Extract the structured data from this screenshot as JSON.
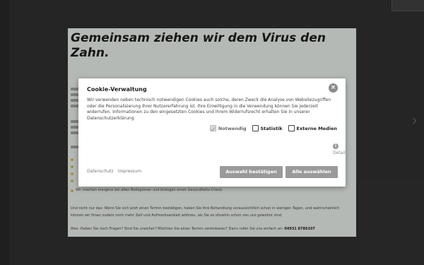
{
  "page": {
    "headline": "Gemeinsam ziehen wir dem Virus den Zahn.",
    "bullet_text": "Wir machen morgens bei allen Biologinnen und biologen einen Gesundheits-Check.",
    "para1": "Und nicht nur das: Wenn Sie sich jetzt einen Termin bestätigen, haben Sie Ihre Behandlung voraussichtlich schon in wenigen Tagen, und wahrscheinlich",
    "para2": "können wir Ihnen zudem noch mehr Zeit und Aufmerksamkeit widmen, als Sie es ohnehin schon von uns gewohnt sind.",
    "contact_text": "Also: Haben Sie noch Fragen? Sind Sie unsicher? Möchten Sie einen Termin vereinbaren? Dann rufen Sie uns einfach an:",
    "contact_phone": "04931 8786107"
  },
  "cookie_modal": {
    "title": "Cookie-Verwaltung",
    "close_symbol": "×",
    "text": "Wir verwenden neben technisch notwendigen Cookies auch solche, deren Zweck die Analyse von Websitezugriffen oder die Personalisierung Ihrer Nutzererfahrung ist. Ihre Einwilligung in die Verwendung können Sie jederzeit widerrufen. Informationen zu den eingesetzten Cookies und Ihrem Widerrufsrecht erhalten Sie in unserer Datenschutzerklärung.",
    "options": [
      {
        "label": "Notwendig",
        "checked": true,
        "disabled": true
      },
      {
        "label": "Statistik",
        "checked": false,
        "disabled": false
      },
      {
        "label": "Externe Medien",
        "checked": false,
        "disabled": false
      }
    ],
    "info_symbol": "i",
    "details_link": "Details anzeigen",
    "links": {
      "privacy": "Datenschutz",
      "imprint": "Impressum"
    },
    "buttons": {
      "confirm": "Auswahl bestätigen",
      "accept_all": "Alle auswählen"
    }
  },
  "colors": {
    "overlay": "#000000",
    "button": "#9a9a9a",
    "panel": "#cfd3cf"
  }
}
